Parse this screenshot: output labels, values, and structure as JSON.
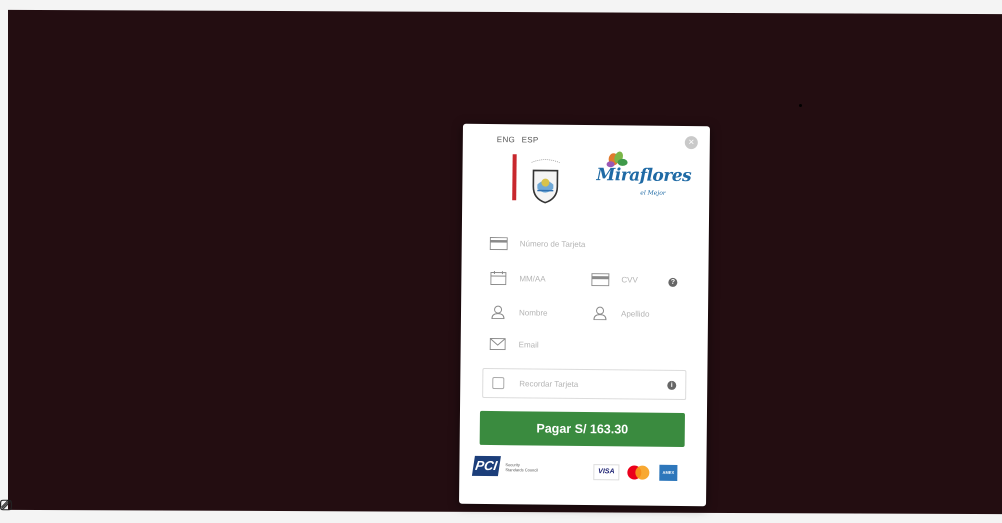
{
  "language": {
    "options": [
      "ENG",
      "ESP"
    ]
  },
  "close_icon": "close-icon",
  "brand": {
    "main": "Miraflores",
    "sub": "el Mejor"
  },
  "form": {
    "card_number_placeholder": "Número de Tarjeta",
    "expiry_placeholder": "MM/AA",
    "cvv_placeholder": "CVV",
    "first_name_placeholder": "Nombre",
    "last_name_placeholder": "Apellido",
    "email_placeholder": "Email",
    "help": "?",
    "remember_label": "Recordar Tarjeta",
    "remember_info": "i"
  },
  "pay_button": {
    "label": "Pagar S/ 163.30"
  },
  "footer": {
    "pci_mark": "PCI",
    "pci_text_1": "Security",
    "pci_text_2": "Standards Council",
    "visa": "VISA",
    "amex": "AMEX"
  },
  "colors": {
    "backdrop": "#230d11",
    "accent_green": "#3a8b3f",
    "brand_blue": "#1f6aa5",
    "brand_red": "#c8272d"
  }
}
